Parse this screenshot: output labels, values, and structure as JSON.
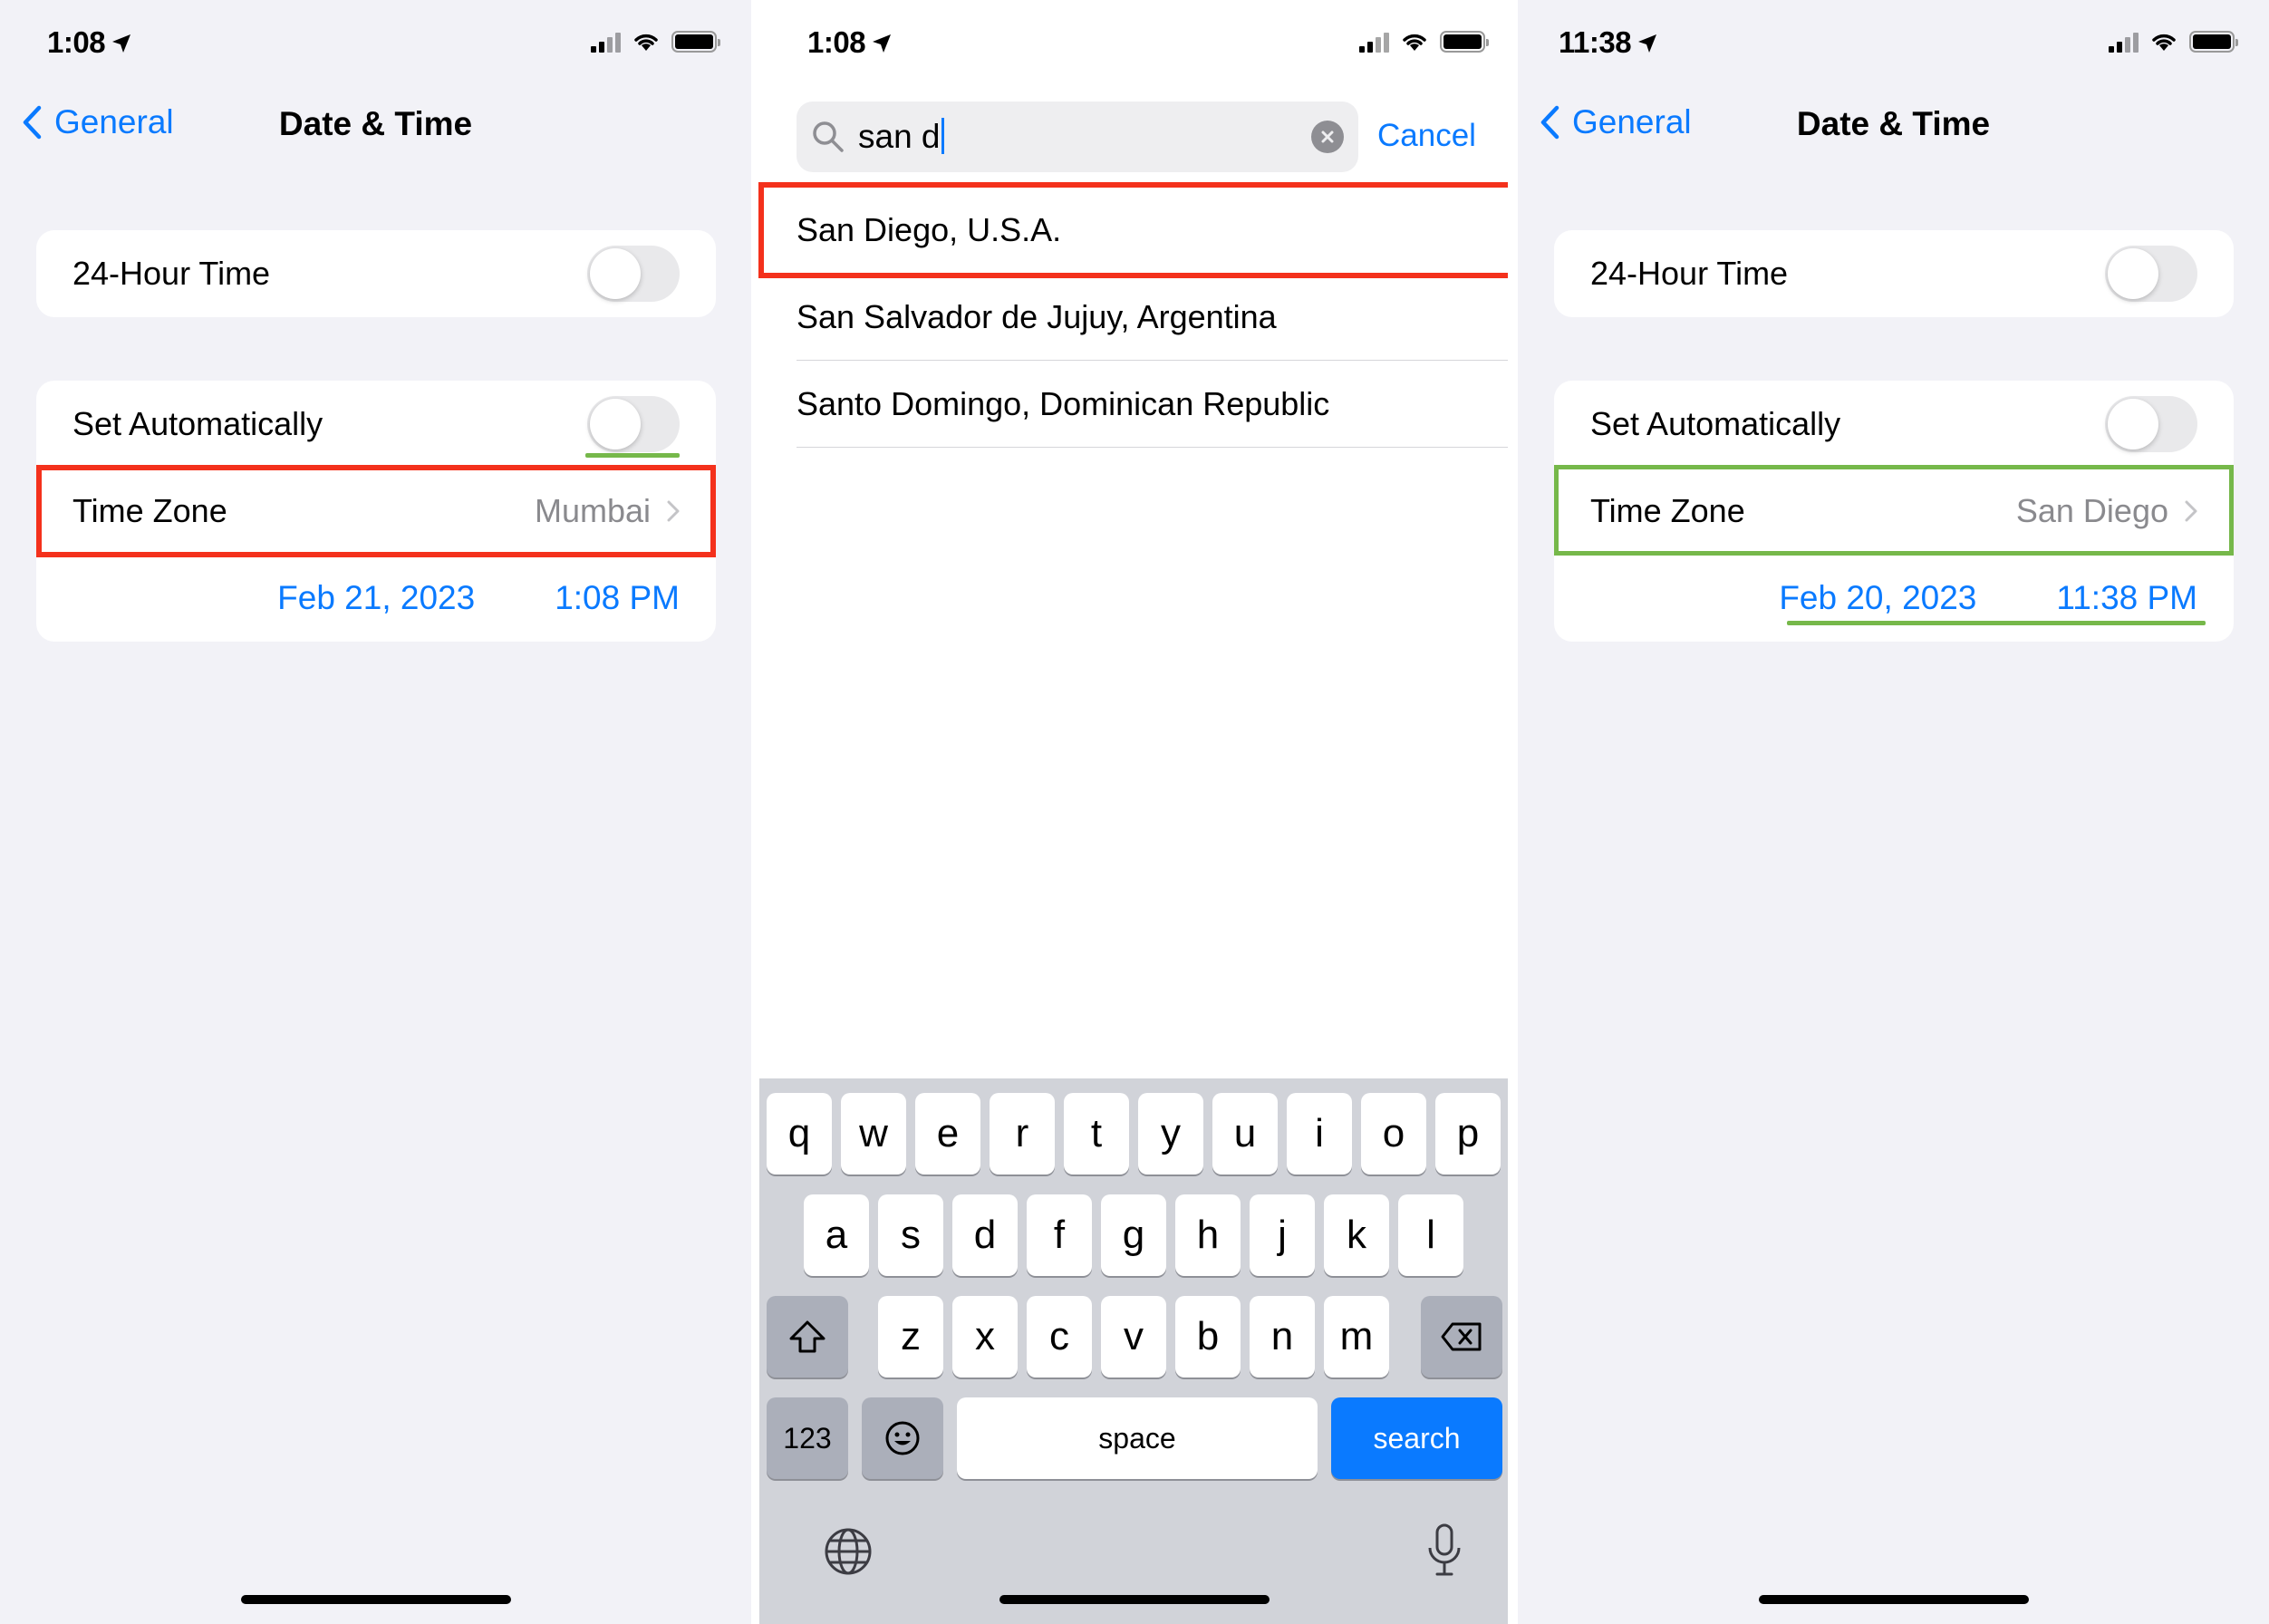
{
  "panel1": {
    "status_time": "1:08",
    "back_label": "General",
    "title": "Date & Time",
    "hour24_label": "24-Hour Time",
    "set_auto_label": "Set Automatically",
    "timezone_label": "Time Zone",
    "timezone_value": "Mumbai",
    "date": "Feb 21, 2023",
    "time": "1:08 PM"
  },
  "panel2": {
    "status_time": "1:08",
    "search_text": "san d",
    "cancel_label": "Cancel",
    "results": [
      "San Diego, U.S.A.",
      "San Salvador de Jujuy, Argentina",
      "Santo Domingo, Dominican Republic"
    ],
    "keyboard": {
      "row1": [
        "q",
        "w",
        "e",
        "r",
        "t",
        "y",
        "u",
        "i",
        "o",
        "p"
      ],
      "row2": [
        "a",
        "s",
        "d",
        "f",
        "g",
        "h",
        "j",
        "k",
        "l"
      ],
      "row3": [
        "z",
        "x",
        "c",
        "v",
        "b",
        "n",
        "m"
      ],
      "numbers_label": "123",
      "space_label": "space",
      "search_label": "search"
    }
  },
  "panel3": {
    "status_time": "11:38",
    "back_label": "General",
    "title": "Date & Time",
    "hour24_label": "24-Hour Time",
    "set_auto_label": "Set Automatically",
    "timezone_label": "Time Zone",
    "timezone_value": "San Diego",
    "date": "Feb 20, 2023",
    "time": "11:38 PM"
  },
  "colors": {
    "accent": "#0a7aff",
    "highlight_red": "#f4311c",
    "highlight_green": "#76b84a"
  }
}
